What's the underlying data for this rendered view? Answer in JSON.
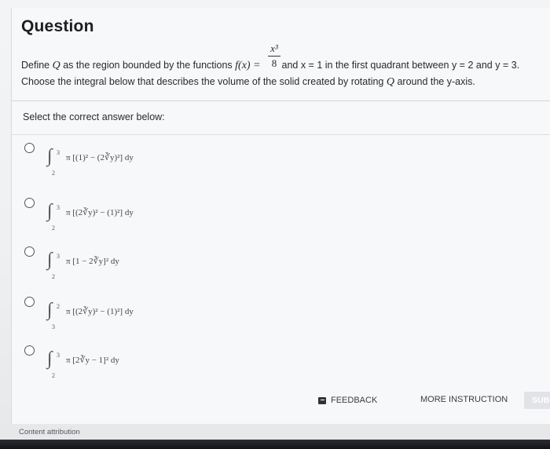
{
  "header": {
    "title": "Question"
  },
  "question": {
    "line1_prefix": "Define",
    "region_symbol": "Q",
    "line1_mid": "as the region bounded by the functions",
    "function_lhs": "f(x) =",
    "frac_numerator": "x³",
    "frac_denominator": "8",
    "line1_rest": "and x = 1 in the first quadrant between y = 2 and y = 3.",
    "line2_prefix": "Choose the integral below that describes the volume of the solid created by rotating",
    "line2_suffix": "around the y-axis."
  },
  "answers": {
    "prompt": "Select the correct answer below:",
    "options": [
      {
        "upper": "3",
        "lower": "2",
        "expr": "π [(1)² − (2∛y)²] dy"
      },
      {
        "upper": "3",
        "lower": "2",
        "expr": "π [(2∛y)² − (1)²] dy"
      },
      {
        "upper": "3",
        "lower": "2",
        "expr": "π [1 − 2∛y]² dy"
      },
      {
        "upper": "2",
        "lower": "3",
        "expr": "π [(2∛y)² − (1)²] dy"
      },
      {
        "upper": "3",
        "lower": "2",
        "expr": "π [2∛y − 1]² dy"
      }
    ]
  },
  "actions": {
    "feedback_label": "FEEDBACK",
    "more_instruction_label": "MORE INSTRUCTION",
    "submit_label": "SUBMIT"
  },
  "footer": {
    "attribution": "Content attribution"
  },
  "icons": {
    "feedback": "feedback-flag-icon",
    "radio": "radio-unselected-icon"
  },
  "colors": {
    "background": "#f3f4f6",
    "text": "#2a2a2a",
    "submit_bg": "#e1e3e6"
  }
}
